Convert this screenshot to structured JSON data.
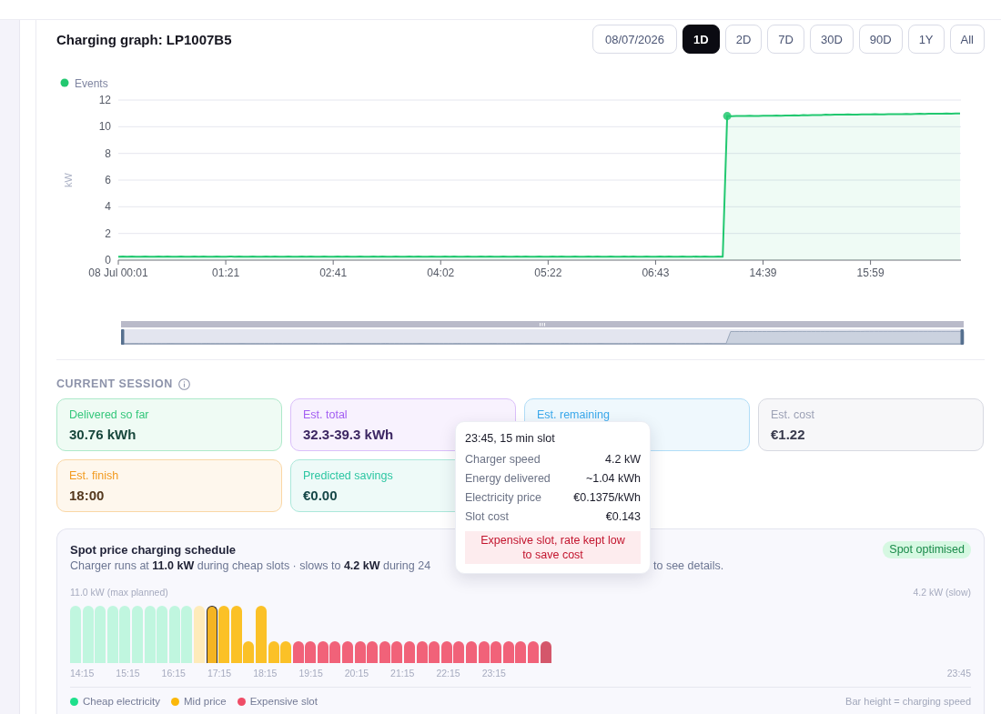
{
  "graph": {
    "title": "Charging graph: LP1007B5",
    "date": "08/07/2026",
    "ranges": [
      {
        "label": "1D",
        "selected": true
      },
      {
        "label": "2D",
        "selected": false
      },
      {
        "label": "7D",
        "selected": false
      },
      {
        "label": "30D",
        "selected": false
      },
      {
        "label": "90D",
        "selected": false
      },
      {
        "label": "1Y",
        "selected": false
      },
      {
        "label": "All",
        "selected": false
      }
    ],
    "chart_data": {
      "type": "area",
      "ylabel": "kW",
      "grid": true,
      "categories": [
        "08 Jul 00:01",
        null,
        null,
        null,
        null,
        null,
        null,
        null,
        null,
        null,
        null,
        null,
        null,
        null,
        null,
        null,
        null,
        null,
        null,
        null,
        null,
        null,
        null,
        null,
        "01:21",
        null,
        null,
        null,
        null,
        null,
        null,
        null,
        null,
        null,
        null,
        null,
        null,
        null,
        null,
        null,
        null,
        null,
        null,
        null,
        null,
        null,
        null,
        null,
        "02:41",
        null,
        null,
        null,
        null,
        null,
        null,
        null,
        null,
        null,
        null,
        null,
        null,
        null,
        null,
        null,
        null,
        null,
        null,
        null,
        null,
        null,
        null,
        null,
        "04:02",
        null,
        null,
        null,
        null,
        null,
        null,
        null,
        null,
        null,
        null,
        null,
        null,
        null,
        null,
        null,
        null,
        null,
        null,
        null,
        null,
        null,
        null,
        null,
        "05:22",
        null,
        null,
        null,
        null,
        null,
        null,
        null,
        null,
        null,
        null,
        null,
        null,
        null,
        null,
        null,
        null,
        null,
        null,
        null,
        null,
        null,
        null,
        null,
        "06:43",
        null,
        null,
        null,
        null,
        null,
        null,
        null,
        null,
        null,
        null,
        null,
        null,
        null,
        null,
        null,
        null,
        null,
        null,
        null,
        null,
        null,
        null,
        null,
        "14:39",
        null,
        null,
        null,
        null,
        null,
        null,
        null,
        null,
        null,
        null,
        null,
        null,
        null,
        null,
        null,
        null,
        null,
        null,
        null,
        null,
        null,
        null,
        null,
        "15:59",
        null,
        null,
        null,
        null,
        null,
        null,
        null,
        null,
        null,
        null,
        null,
        null,
        null,
        null,
        null,
        null,
        null,
        null,
        null,
        null
      ],
      "series": [
        {
          "name": "Events",
          "color": "#22c870",
          "values": [
            0.25,
            0.27,
            0.26,
            0.28,
            0.26,
            0.25,
            0.27,
            0.26,
            0.25,
            0.27,
            0.26,
            0.28,
            0.26,
            0.25,
            0.27,
            0.26,
            0.25,
            0.27,
            0.26,
            0.28,
            0.26,
            0.25,
            0.27,
            0.26,
            0.25,
            0.27,
            0.26,
            0.28,
            0.26,
            0.25,
            0.27,
            0.26,
            0.25,
            0.27,
            0.26,
            0.28,
            0.26,
            0.25,
            0.27,
            0.26,
            0.25,
            0.27,
            0.26,
            0.28,
            0.26,
            0.25,
            0.27,
            0.26,
            0.25,
            0.27,
            0.26,
            0.28,
            0.26,
            0.25,
            0.27,
            0.26,
            0.25,
            0.27,
            0.26,
            0.28,
            0.26,
            0.25,
            0.27,
            0.26,
            0.25,
            0.27,
            0.26,
            0.28,
            0.26,
            0.25,
            0.27,
            0.26,
            0.25,
            0.27,
            0.26,
            0.28,
            0.26,
            0.25,
            0.27,
            0.26,
            0.25,
            0.27,
            0.26,
            0.28,
            0.26,
            0.25,
            0.27,
            0.26,
            0.25,
            0.27,
            0.26,
            0.28,
            0.26,
            0.25,
            0.27,
            0.26,
            0.25,
            0.27,
            0.26,
            0.28,
            0.26,
            0.25,
            0.27,
            0.26,
            0.25,
            0.27,
            0.26,
            0.28,
            0.26,
            0.25,
            0.27,
            0.26,
            0.25,
            0.27,
            0.26,
            0.28,
            0.26,
            0.25,
            0.27,
            0.26,
            0.25,
            0.27,
            0.26,
            0.28,
            0.26,
            0.25,
            0.27,
            0.26,
            0.25,
            0.27,
            0.26,
            0.28,
            0.26,
            0.25,
            0.27,
            0.26,
            10.8,
            10.79,
            10.8,
            10.81,
            10.8,
            10.82,
            10.81,
            10.8,
            10.82,
            10.83,
            10.82,
            10.84,
            10.83,
            10.85,
            10.84,
            10.86,
            10.85,
            10.87,
            10.86,
            10.88,
            10.87,
            10.88,
            10.9,
            10.89,
            10.9,
            10.91,
            10.9,
            10.92,
            10.91,
            10.9,
            10.92,
            10.93,
            10.92,
            10.94,
            10.93,
            10.92,
            10.94,
            10.95,
            10.94,
            10.95,
            10.96,
            10.95,
            10.96,
            10.97,
            10.96,
            10.97,
            10.98,
            10.97,
            10.98,
            10.99,
            10.98,
            10.99,
            11.0
          ]
        }
      ],
      "ylim": [
        0,
        12
      ],
      "yticks": [
        0,
        2,
        4,
        6,
        8,
        10,
        12
      ]
    }
  },
  "session": {
    "title": "CURRENT SESSION",
    "cards": [
      {
        "label": "Delivered so far",
        "value": "30.76 kWh",
        "color": "#34c77b"
      },
      {
        "label": "Est. total",
        "value": "32.3-39.3 kWh",
        "color": "#a35ef2"
      },
      {
        "label": "Est. remaining",
        "color": "#3ba9ec"
      },
      {
        "label": "Est. cost",
        "value": "€1.22",
        "color": "#9ca1b5"
      },
      {
        "label": "Est. finish",
        "value": "18:00",
        "color": "#f29a1f"
      },
      {
        "label": "Predicted savings",
        "value": "€0.00",
        "color": "#2cc6a2"
      }
    ]
  },
  "tooltip": {
    "title": "23:45, 15 min slot",
    "rows": [
      {
        "label": "Charger speed",
        "value": "4.2 kW"
      },
      {
        "label": "Energy delivered",
        "value": "~1.04 kWh"
      },
      {
        "label": "Electricity price",
        "value": "€0.1375/kWh"
      },
      {
        "label": "Slot cost",
        "value": "€0.143"
      }
    ],
    "note": "Expensive slot, rate kept low to save cost"
  },
  "schedule": {
    "title": "Spot price charging schedule",
    "badge": "Spot optimised",
    "description_parts": [
      "Charger runs at **11.0 kW** during cheap slots · slows to **4.2 kW** during 24",
      "to see details."
    ],
    "max_label": "11.0 kW (max planned)",
    "slow_label": "4.2 kW (slow)",
    "bars": [
      {
        "kind": "cheap",
        "slow": false,
        "past": true,
        "current": false,
        "hovered": false
      },
      {
        "kind": "cheap",
        "slow": false,
        "past": true,
        "current": false,
        "hovered": false
      },
      {
        "kind": "cheap",
        "slow": false,
        "past": true,
        "current": false,
        "hovered": false
      },
      {
        "kind": "cheap",
        "slow": false,
        "past": true,
        "current": false,
        "hovered": false
      },
      {
        "kind": "cheap",
        "slow": false,
        "past": true,
        "current": false,
        "hovered": false
      },
      {
        "kind": "cheap",
        "slow": false,
        "past": true,
        "current": false,
        "hovered": false
      },
      {
        "kind": "cheap",
        "slow": false,
        "past": true,
        "current": false,
        "hovered": false
      },
      {
        "kind": "cheap",
        "slow": false,
        "past": true,
        "current": false,
        "hovered": false
      },
      {
        "kind": "cheap",
        "slow": false,
        "past": true,
        "current": false,
        "hovered": false
      },
      {
        "kind": "cheap",
        "slow": false,
        "past": true,
        "current": false,
        "hovered": false
      },
      {
        "kind": "mid",
        "slow": false,
        "past": true,
        "current": false,
        "hovered": false
      },
      {
        "kind": "mid",
        "slow": false,
        "past": false,
        "current": true,
        "hovered": false
      },
      {
        "kind": "mid",
        "slow": false,
        "past": false,
        "current": false,
        "hovered": false
      },
      {
        "kind": "mid",
        "slow": false,
        "past": false,
        "current": false,
        "hovered": false
      },
      {
        "kind": "mid",
        "slow": true,
        "past": false,
        "current": false,
        "hovered": false
      },
      {
        "kind": "mid",
        "slow": false,
        "past": false,
        "current": false,
        "hovered": false
      },
      {
        "kind": "mid",
        "slow": true,
        "past": false,
        "current": false,
        "hovered": false
      },
      {
        "kind": "mid",
        "slow": true,
        "past": false,
        "current": false,
        "hovered": false
      },
      {
        "kind": "expensive",
        "slow": true,
        "past": false,
        "current": false,
        "hovered": false
      },
      {
        "kind": "expensive",
        "slow": true,
        "past": false,
        "current": false,
        "hovered": false
      },
      {
        "kind": "expensive",
        "slow": true,
        "past": false,
        "current": false,
        "hovered": false
      },
      {
        "kind": "expensive",
        "slow": true,
        "past": false,
        "current": false,
        "hovered": false
      },
      {
        "kind": "expensive",
        "slow": true,
        "past": false,
        "current": false,
        "hovered": false
      },
      {
        "kind": "expensive",
        "slow": true,
        "past": false,
        "current": false,
        "hovered": false
      },
      {
        "kind": "expensive",
        "slow": true,
        "past": false,
        "current": false,
        "hovered": false
      },
      {
        "kind": "expensive",
        "slow": true,
        "past": false,
        "current": false,
        "hovered": false
      },
      {
        "kind": "expensive",
        "slow": true,
        "past": false,
        "current": false,
        "hovered": false
      },
      {
        "kind": "expensive",
        "slow": true,
        "past": false,
        "current": false,
        "hovered": false
      },
      {
        "kind": "expensive",
        "slow": true,
        "past": false,
        "current": false,
        "hovered": false
      },
      {
        "kind": "expensive",
        "slow": true,
        "past": false,
        "current": false,
        "hovered": false
      },
      {
        "kind": "expensive",
        "slow": true,
        "past": false,
        "current": false,
        "hovered": false
      },
      {
        "kind": "expensive",
        "slow": true,
        "past": false,
        "current": false,
        "hovered": false
      },
      {
        "kind": "expensive",
        "slow": true,
        "past": false,
        "current": false,
        "hovered": false
      },
      {
        "kind": "expensive",
        "slow": true,
        "past": false,
        "current": false,
        "hovered": false
      },
      {
        "kind": "expensive",
        "slow": true,
        "past": false,
        "current": false,
        "hovered": false
      },
      {
        "kind": "expensive",
        "slow": true,
        "past": false,
        "current": false,
        "hovered": false
      },
      {
        "kind": "expensive",
        "slow": true,
        "past": false,
        "current": false,
        "hovered": false
      },
      {
        "kind": "expensive",
        "slow": true,
        "past": false,
        "current": false,
        "hovered": false
      },
      {
        "kind": "expensive",
        "slow": true,
        "past": false,
        "current": false,
        "hovered": true
      }
    ],
    "axis_labels": [
      "14:15",
      "15:15",
      "16:15",
      "17:15",
      "18:15",
      "19:15",
      "20:15",
      "21:15",
      "22:15",
      "23:15"
    ],
    "end_label": "23:45",
    "legend": [
      {
        "kind": "cheap",
        "label": "Cheap electricity",
        "color": "#1fe08c"
      },
      {
        "kind": "mid",
        "label": "Mid price",
        "color": "#fbb80a"
      },
      {
        "kind": "expensive",
        "label": "Expensive slot",
        "color": "#ef4d67"
      }
    ],
    "note": "Bar height = charging speed"
  }
}
